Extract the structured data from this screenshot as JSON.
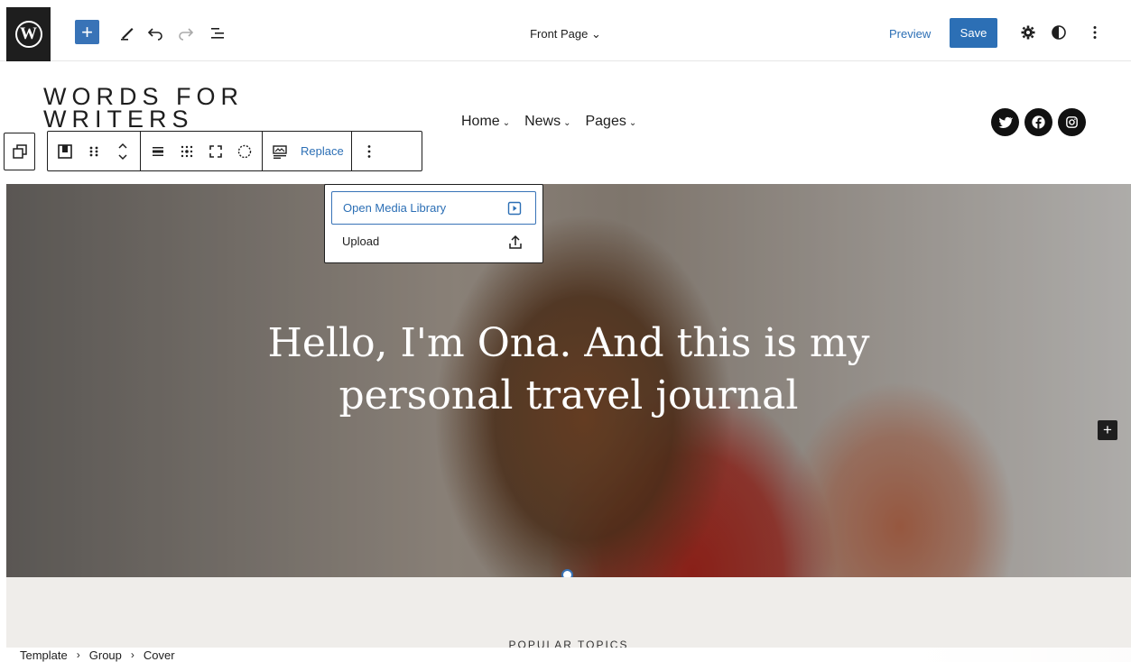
{
  "topbar": {
    "logo_glyph": "W",
    "document_title": "Front Page",
    "document_title_chevron": "⌄",
    "preview_label": "Preview",
    "save_label": "Save"
  },
  "site": {
    "title": "WORDS FOR WRITERS",
    "nav": [
      {
        "label": "Home"
      },
      {
        "label": "News"
      },
      {
        "label": "Pages"
      }
    ],
    "nav_chevron": "⌄",
    "social": [
      "twitter-icon",
      "facebook-icon",
      "instagram-icon"
    ]
  },
  "block_toolbar": {
    "replace_label": "Replace"
  },
  "dropdown": {
    "items": [
      {
        "label": "Open Media Library"
      },
      {
        "label": "Upload"
      }
    ]
  },
  "cover": {
    "heading": "Hello, I'm Ona. And this is my personal travel journal"
  },
  "below": {
    "popular_topics": "POPULAR TOPICS"
  },
  "breadcrumb": {
    "items": [
      "Template",
      "Group",
      "Cover"
    ],
    "separator": "›"
  },
  "colors": {
    "accent": "#2c6fb5",
    "dark": "#1e1e1e",
    "section_bg": "#efedea"
  }
}
